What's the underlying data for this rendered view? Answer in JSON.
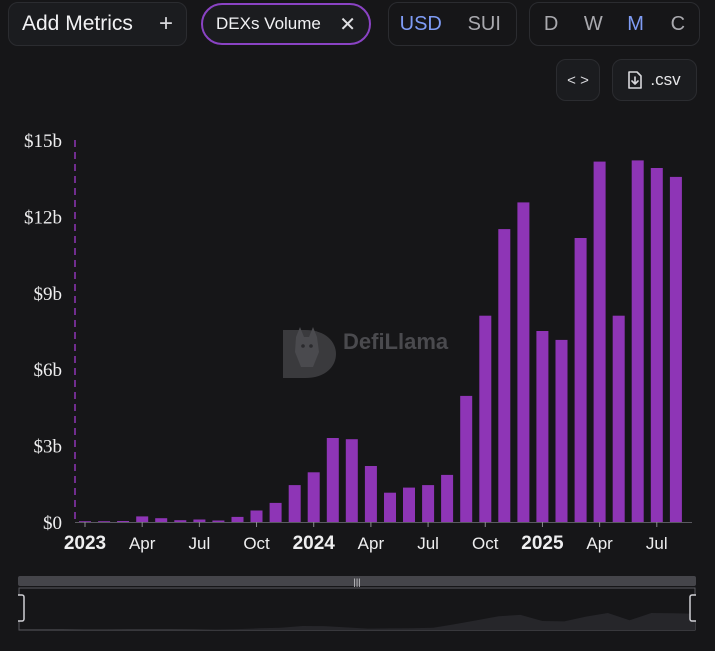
{
  "toolbar": {
    "add_metrics_label": "Add Metrics",
    "add_icon": "plus-icon",
    "metric_chip_label": "DEXs Volume",
    "remove_icon": "close-icon",
    "currency_options": [
      "USD",
      "SUI"
    ],
    "currency_selected": "USD",
    "period_options": [
      "D",
      "W",
      "M",
      "C"
    ],
    "period_selected": "M",
    "embed_icon": "code-icon",
    "csv_label": ".csv",
    "csv_icon": "download-file-icon"
  },
  "colors": {
    "background": "#161618",
    "bar": "#8e35b6",
    "chip_border": "#8a43c4",
    "active_option": "#7f9cf5",
    "marker_line": "#8e35b6"
  },
  "watermark": "DefiLlama",
  "chart_data": {
    "type": "bar",
    "ylim": [
      0,
      15
    ],
    "yunit": "billion USD",
    "y_ticks": [
      "$0",
      "$3b",
      "$6b",
      "$9b",
      "$12b",
      "$15b"
    ],
    "x_ticks": [
      {
        "label": "2023",
        "bold": true
      },
      {
        "label": "Apr",
        "bold": false
      },
      {
        "label": "Jul",
        "bold": false
      },
      {
        "label": "Oct",
        "bold": false
      },
      {
        "label": "2024",
        "bold": true
      },
      {
        "label": "Apr",
        "bold": false
      },
      {
        "label": "Jul",
        "bold": false
      },
      {
        "label": "Oct",
        "bold": false
      },
      {
        "label": "2025",
        "bold": true
      },
      {
        "label": "Apr",
        "bold": false
      },
      {
        "label": "Jul",
        "bold": false
      }
    ],
    "categories": [
      "2023-01",
      "2023-02",
      "2023-03",
      "2023-04",
      "2023-05",
      "2023-06",
      "2023-07",
      "2023-08",
      "2023-09",
      "2023-10",
      "2023-11",
      "2023-12",
      "2024-01",
      "2024-02",
      "2024-03",
      "2024-04",
      "2024-05",
      "2024-06",
      "2024-07",
      "2024-08",
      "2024-09",
      "2024-10",
      "2024-11",
      "2024-12",
      "2025-01",
      "2025-02",
      "2025-03",
      "2025-04",
      "2025-05",
      "2025-06",
      "2025-07",
      "2025-08",
      "2025-09"
    ],
    "values": [
      0.03,
      0.03,
      0.04,
      0.22,
      0.15,
      0.07,
      0.1,
      0.06,
      0.2,
      0.45,
      0.75,
      1.45,
      1.95,
      3.3,
      3.25,
      2.2,
      1.15,
      1.35,
      1.45,
      1.85,
      4.95,
      8.1,
      11.5,
      12.55,
      7.5,
      7.15,
      11.15,
      14.15,
      8.1,
      14.2,
      13.9,
      13.55
    ],
    "grid": false,
    "legend": "none",
    "range_selector": {
      "start": 0,
      "end": 1
    }
  }
}
